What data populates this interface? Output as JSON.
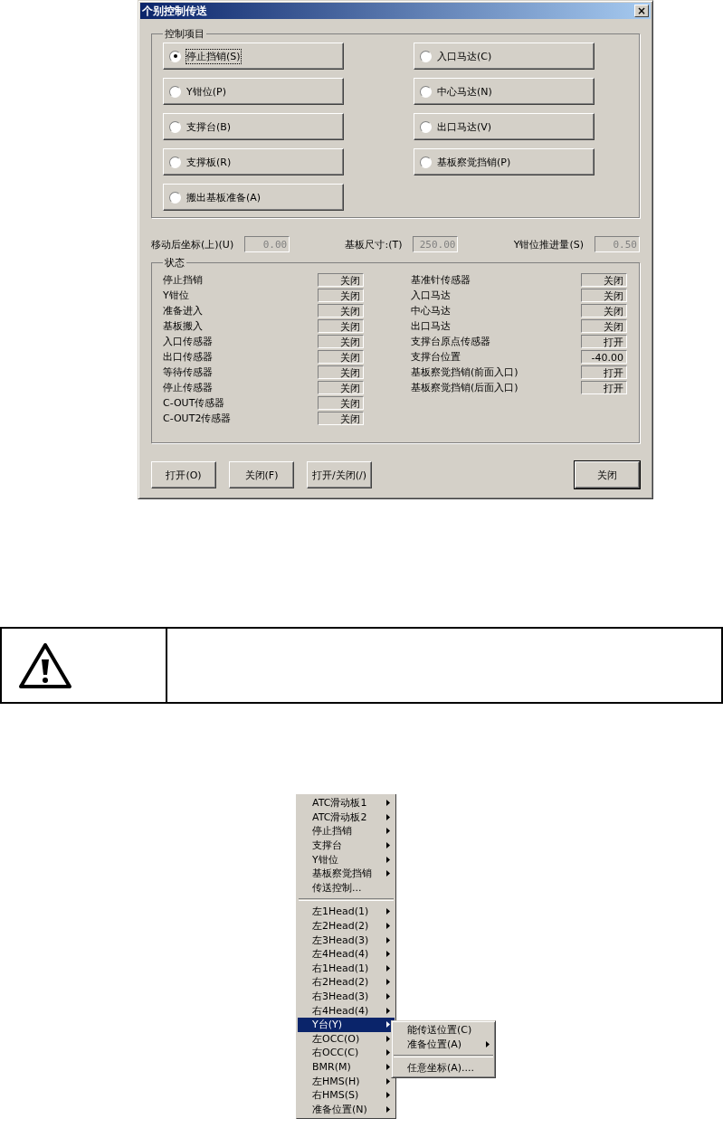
{
  "dialog": {
    "title": "个别控制传送",
    "close_glyph": "×",
    "control_group": {
      "title": "控制项目",
      "left_options": [
        {
          "label": "停止挡销(S)",
          "selected": true
        },
        {
          "label": "Y钳位(P)",
          "selected": false
        },
        {
          "label": "支撑台(B)",
          "selected": false
        },
        {
          "label": "支撑板(R)",
          "selected": false
        },
        {
          "label": "搬出基板准备(A)",
          "selected": false
        }
      ],
      "right_options": [
        {
          "label": "入口马达(C)",
          "selected": false
        },
        {
          "label": "中心马达(N)",
          "selected": false
        },
        {
          "label": "出口马达(V)",
          "selected": false
        },
        {
          "label": "基板察觉挡销(P)",
          "selected": false
        }
      ]
    },
    "params": [
      {
        "label": "移动后坐标(上)(U)",
        "value": "0.00"
      },
      {
        "label": "基板尺寸:(T)",
        "value": "250.00"
      },
      {
        "label": "Y钳位推进量(S)",
        "value": "0.50"
      }
    ],
    "status_group": {
      "title": "状态",
      "left": [
        {
          "label": "停止挡销",
          "value": "关闭"
        },
        {
          "label": "Y钳位",
          "value": "关闭"
        },
        {
          "label": "准备进入",
          "value": "关闭"
        },
        {
          "label": "基板搬入",
          "value": "关闭"
        },
        {
          "label": "入口传感器",
          "value": "关闭"
        },
        {
          "label": "出口传感器",
          "value": "关闭"
        },
        {
          "label": "等待传感器",
          "value": "关闭"
        },
        {
          "label": "停止传感器",
          "value": "关闭"
        },
        {
          "label": "C-OUT传感器",
          "value": "关闭"
        },
        {
          "label": "C-OUT2传感器",
          "value": "关闭"
        }
      ],
      "right": [
        {
          "label": "基准针传感器",
          "value": "关闭"
        },
        {
          "label": "入口马达",
          "value": "关闭"
        },
        {
          "label": "中心马达",
          "value": "关闭"
        },
        {
          "label": "出口马达",
          "value": "关闭"
        },
        {
          "label": "支撑台原点传感器",
          "value": "打开"
        },
        {
          "label": "支撑台位置",
          "value": "-40.00"
        },
        {
          "label": "基板察觉挡销(前面入口)",
          "value": "打开"
        },
        {
          "label": "基板察觉挡销(后面入口)",
          "value": "打开"
        }
      ]
    },
    "buttons": [
      "打开(O)",
      "关闭(F)",
      "打开/关闭(/)"
    ],
    "close_button": "关闭"
  },
  "notice": {
    "kind": "warning"
  },
  "context_menu": {
    "items": [
      {
        "kind": "item",
        "label": "ATC滑动板1",
        "submenu": true,
        "selected": false
      },
      {
        "kind": "item",
        "label": "ATC滑动板2",
        "submenu": true,
        "selected": false
      },
      {
        "kind": "item",
        "label": "停止挡销",
        "submenu": true,
        "selected": false
      },
      {
        "kind": "item",
        "label": "支撑台",
        "submenu": true,
        "selected": false
      },
      {
        "kind": "item",
        "label": "Y钳位",
        "submenu": true,
        "selected": false
      },
      {
        "kind": "item",
        "label": "基板察觉挡销",
        "submenu": true,
        "selected": false
      },
      {
        "kind": "item",
        "label": "传送控制...",
        "submenu": false,
        "selected": false
      },
      {
        "kind": "separator"
      },
      {
        "kind": "item",
        "label": "左1Head(1)",
        "submenu": true,
        "selected": false
      },
      {
        "kind": "item",
        "label": "左2Head(2)",
        "submenu": true,
        "selected": false
      },
      {
        "kind": "item",
        "label": "左3Head(3)",
        "submenu": true,
        "selected": false
      },
      {
        "kind": "item",
        "label": "左4Head(4)",
        "submenu": true,
        "selected": false
      },
      {
        "kind": "item",
        "label": "右1Head(1)",
        "submenu": true,
        "selected": false
      },
      {
        "kind": "item",
        "label": "右2Head(2)",
        "submenu": true,
        "selected": false
      },
      {
        "kind": "item",
        "label": "右3Head(3)",
        "submenu": true,
        "selected": false
      },
      {
        "kind": "item",
        "label": "右4Head(4)",
        "submenu": true,
        "selected": false
      },
      {
        "kind": "item",
        "label": "Y台(Y)",
        "submenu": true,
        "selected": true
      },
      {
        "kind": "item",
        "label": "左OCC(O)",
        "submenu": true,
        "selected": false
      },
      {
        "kind": "item",
        "label": "右OCC(C)",
        "submenu": true,
        "selected": false
      },
      {
        "kind": "item",
        "label": "BMR(M)",
        "submenu": true,
        "selected": false
      },
      {
        "kind": "item",
        "label": "左HMS(H)",
        "submenu": true,
        "selected": false
      },
      {
        "kind": "item",
        "label": "右HMS(S)",
        "submenu": true,
        "selected": false
      },
      {
        "kind": "item",
        "label": "准备位置(N)",
        "submenu": true,
        "selected": false
      }
    ],
    "submenu": [
      {
        "kind": "item",
        "label": "能传送位置(C)",
        "submenu": false,
        "selected": false
      },
      {
        "kind": "item",
        "label": "准备位置(A)",
        "submenu": true,
        "selected": false
      },
      {
        "kind": "separator"
      },
      {
        "kind": "item",
        "label": "任意坐标(A)....",
        "submenu": false,
        "selected": false
      }
    ]
  }
}
